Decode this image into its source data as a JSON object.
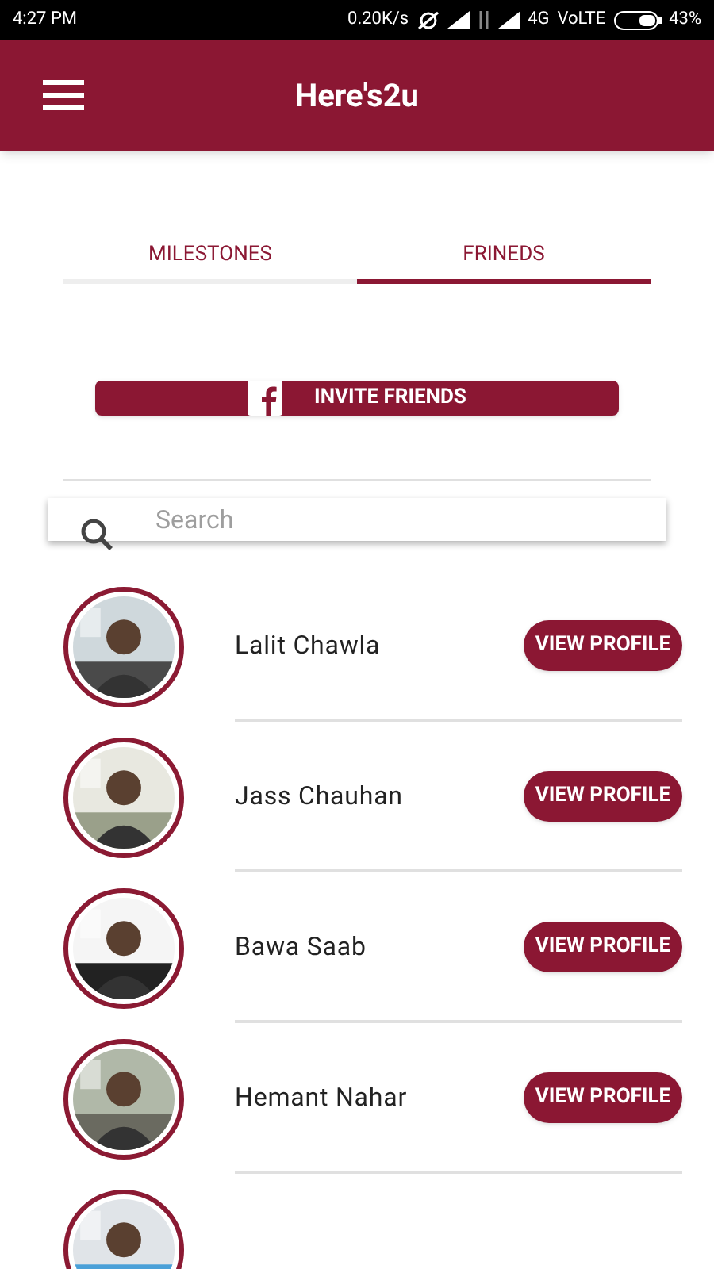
{
  "status_bar": {
    "time": "4:27 PM",
    "speed": "0.20K/s",
    "network": "4G",
    "volte": "VoLTE",
    "battery": "43%"
  },
  "app_bar": {
    "title": "Here's2u"
  },
  "tabs": [
    {
      "label": "MILESTONES",
      "selected": false
    },
    {
      "label": "FRINEDS",
      "selected": true
    }
  ],
  "invite_button": "INVITE FRIENDS",
  "search": {
    "placeholder": "Search"
  },
  "friends": [
    {
      "name": "Lalit Chawla",
      "action": "VIEW PROFILE"
    },
    {
      "name": "Jass Chauhan",
      "action": "VIEW PROFILE"
    },
    {
      "name": "Bawa Saab",
      "action": "VIEW PROFILE"
    },
    {
      "name": "Hemant Nahar",
      "action": "VIEW PROFILE"
    }
  ]
}
